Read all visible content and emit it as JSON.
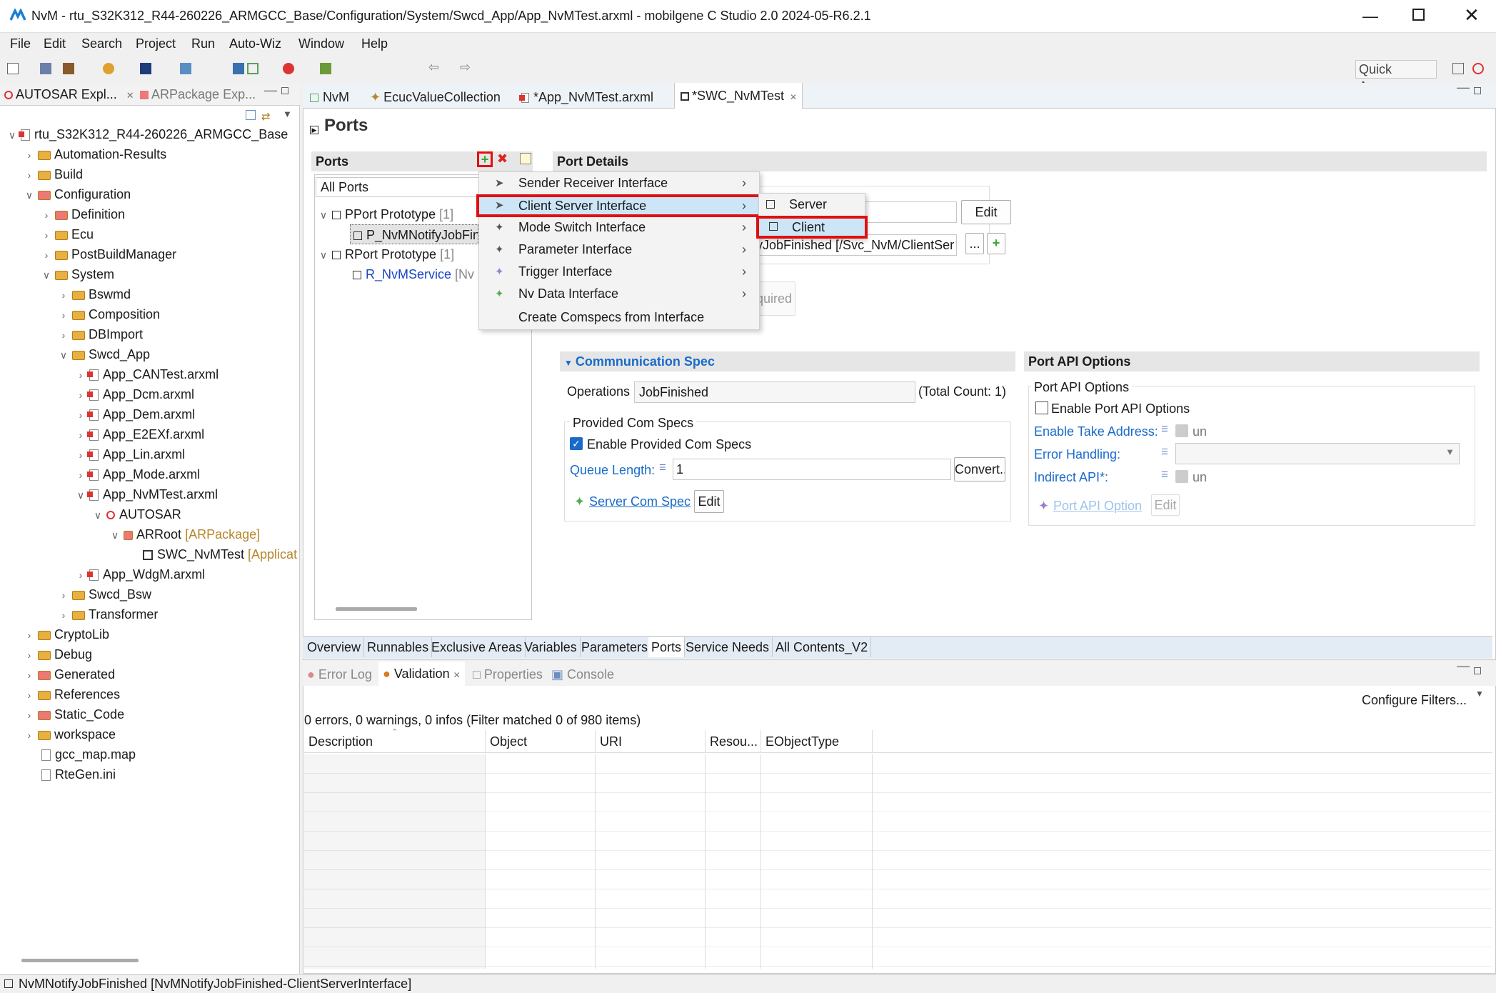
{
  "window": {
    "title": "NvM - rtu_S32K312_R44-260226_ARMGCC_Base/Configuration/System/Swcd_App/App_NvMTest.arxml - mobilgene C Studio 2.0 2024-05-R6.2.1"
  },
  "menubar": [
    "File",
    "Edit",
    "Search",
    "Project",
    "Run",
    "Auto-Wiz",
    "Window",
    "Help"
  ],
  "quick_access": "Quick Access",
  "explorer": {
    "tabs": [
      "AUTOSAR Expl...",
      "ARPackage Exp..."
    ],
    "tree": [
      {
        "label": "rtu_S32K312_R44-260226_ARMGCC_Base"
      },
      {
        "label": "Automation-Results"
      },
      {
        "label": "Build"
      },
      {
        "label": "Configuration"
      },
      {
        "label": "Definition"
      },
      {
        "label": "Ecu"
      },
      {
        "label": "PostBuildManager"
      },
      {
        "label": "System"
      },
      {
        "label": "Bswmd"
      },
      {
        "label": "Composition"
      },
      {
        "label": "DBImport"
      },
      {
        "label": "Swcd_App"
      },
      {
        "label": "App_CANTest.arxml"
      },
      {
        "label": "App_Dcm.arxml"
      },
      {
        "label": "App_Dem.arxml"
      },
      {
        "label": "App_E2EXf.arxml"
      },
      {
        "label": "App_Lin.arxml"
      },
      {
        "label": "App_Mode.arxml"
      },
      {
        "label": "App_NvMTest.arxml"
      },
      {
        "label": "AUTOSAR"
      },
      {
        "label": "ARRoot",
        "suffix": "[ARPackage]"
      },
      {
        "label": "SWC_NvMTest",
        "suffix": "[Applicat"
      },
      {
        "label": "App_WdgM.arxml"
      },
      {
        "label": "Swcd_Bsw"
      },
      {
        "label": "Transformer"
      },
      {
        "label": "CryptoLib"
      },
      {
        "label": "Debug"
      },
      {
        "label": "Generated"
      },
      {
        "label": "References"
      },
      {
        "label": "Static_Code"
      },
      {
        "label": "workspace"
      },
      {
        "label": "gcc_map.map"
      },
      {
        "label": "RteGen.ini"
      }
    ]
  },
  "editor_tabs": [
    "NvM",
    "EcucValueCollection",
    "*App_NvMTest.arxml",
    "*SWC_NvMTest"
  ],
  "page_title": "Ports",
  "ports_panel": {
    "title": "Ports",
    "filter": "All Ports",
    "pport": "PPort Prototype",
    "pport_count": "[1]",
    "pport_item": "P_NvMNotifyJobFin",
    "rport": "RPort Prototype",
    "rport_count": "[1]",
    "rport_item": "R_NvMService",
    "rport_item_suffix": "[Nv"
  },
  "port_details": {
    "title": "Port Details",
    "edit_label": "Edit",
    "interface_value": "yJobFinished [/Svc_NvM/ClientSer",
    "browse_label": "...",
    "required_label": "quired"
  },
  "context_menu": [
    {
      "label": "Sender Receiver Interface"
    },
    {
      "label": "Client Server Interface"
    },
    {
      "label": "Mode Switch Interface"
    },
    {
      "label": "Parameter Interface"
    },
    {
      "label": "Trigger Interface"
    },
    {
      "label": "Nv Data Interface"
    },
    {
      "label": "Create Comspecs from Interface"
    }
  ],
  "submenu": [
    {
      "label": "Server"
    },
    {
      "label": "Client"
    }
  ],
  "comm_spec": {
    "title": "Commnunication Spec",
    "operations_label": "Operations",
    "operations_value": "JobFinished",
    "total_count": "(Total Count: 1)",
    "provided_group": "Provided Com Specs",
    "enable_label": "Enable Provided Com Specs",
    "queue_label": "Queue Length:",
    "queue_value": "1",
    "convert_label": "Convert..",
    "server_link": "Server Com Spec",
    "edit_label": "Edit"
  },
  "api_options": {
    "title": "Port API Options",
    "group": "Port API Options",
    "enable_label": "Enable Port API Options",
    "take_address": "Enable Take Address:",
    "take_address_val": "un",
    "error_handling": "Error Handling:",
    "indirect_api": "Indirect API*:",
    "indirect_val": "un",
    "option_link": "Port API Option",
    "edit_label": "Edit"
  },
  "bottom_tabs": [
    "Overview",
    "Runnables",
    "Exclusive Areas",
    "Variables",
    "Parameters",
    "Ports",
    "Service Needs",
    "All Contents_V2"
  ],
  "view_tabs": [
    "Error Log",
    "Validation",
    "Properties",
    "Console"
  ],
  "validation": {
    "configure": "Configure Filters...",
    "summary": "0 errors, 0 warnings, 0 infos (Filter matched 0 of 980 items)",
    "columns": [
      "Description",
      "Object",
      "URI",
      "Resou...",
      "EObjectType"
    ]
  },
  "status_bar": "NvMNotifyJobFinished [NvMNotifyJobFinished-ClientServerInterface]",
  "colors": {
    "accent": "#1a6bc9",
    "highlight": "#e01010",
    "selection": "#cde6f7"
  }
}
